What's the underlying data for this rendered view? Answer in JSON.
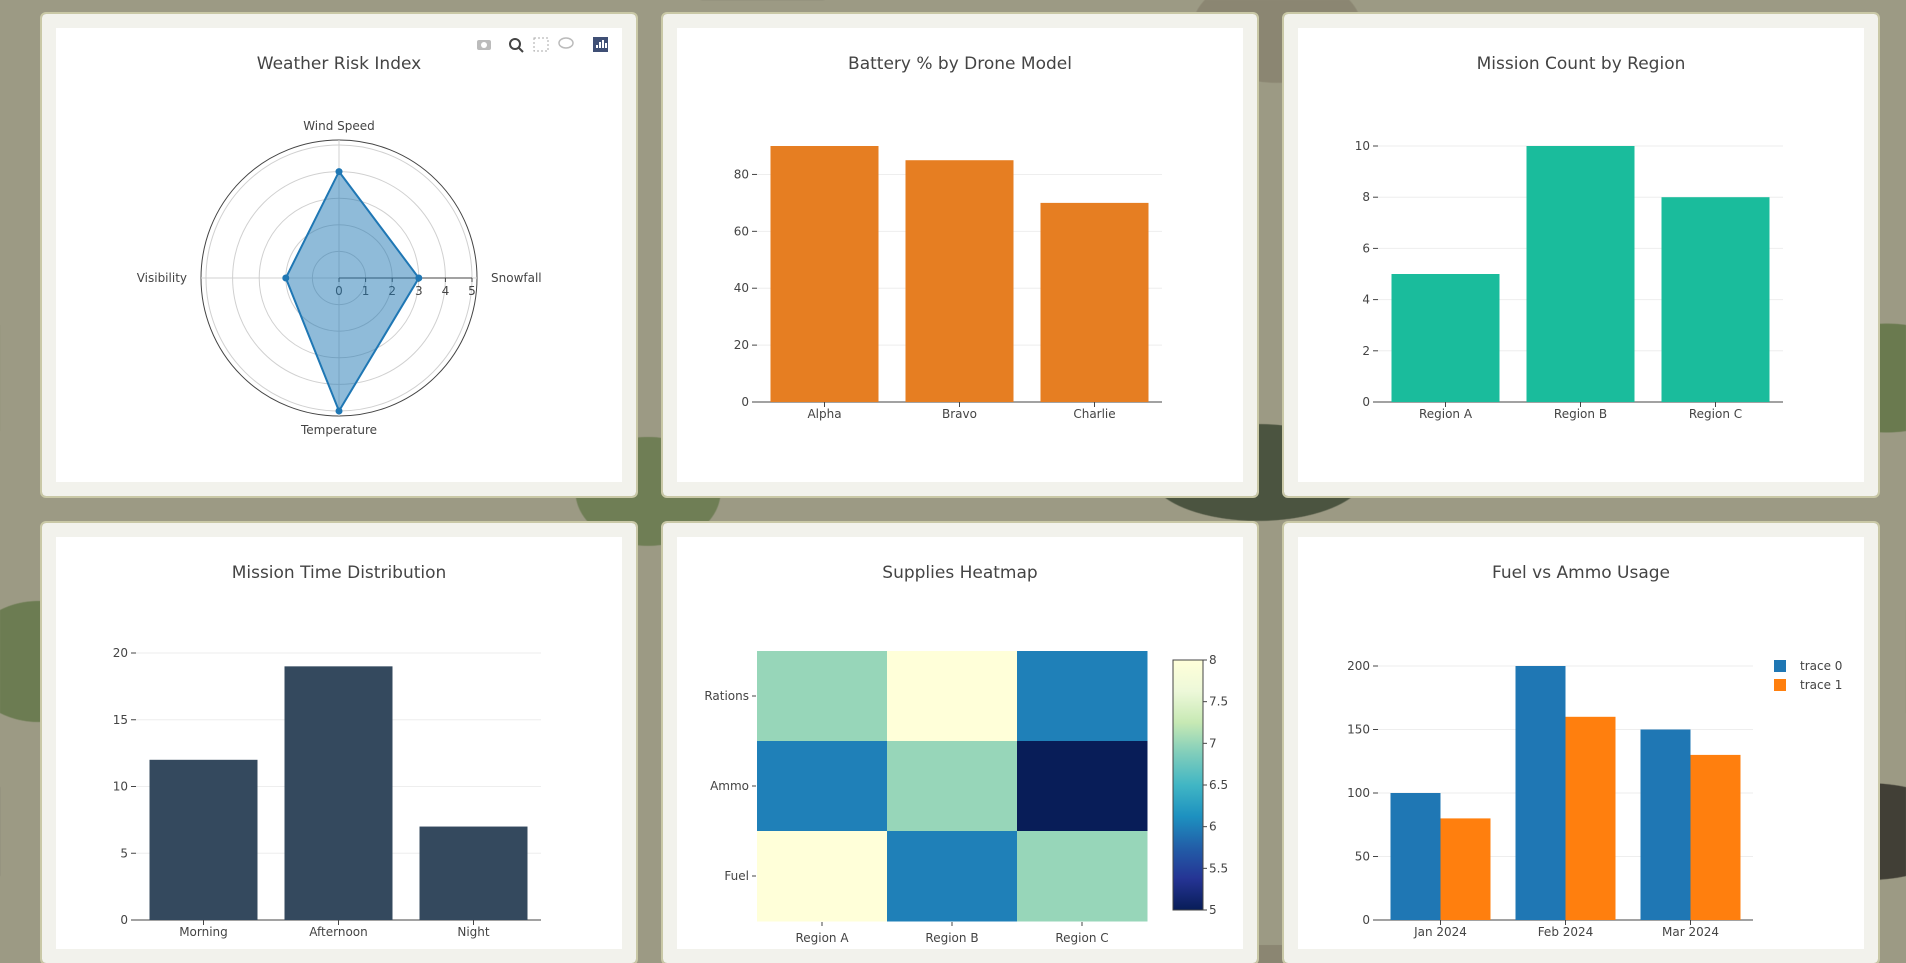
{
  "charts": [
    {
      "id": "radar",
      "type": "radar",
      "title": "Weather Risk Index",
      "axes": [
        "Wind Speed",
        "Snowfall",
        "Temperature",
        "Visibility"
      ],
      "values": [
        4,
        3,
        5,
        2
      ],
      "radial_ticks": [
        "0",
        "1",
        "2",
        "3",
        "4",
        "5"
      ],
      "range": [
        0,
        5
      ],
      "color": "#1f77b4",
      "modebar": [
        "camera-icon",
        "zoom-icon",
        "select-box-icon",
        "comment-icon",
        "plotly-logo-icon"
      ]
    },
    {
      "id": "battery",
      "type": "bar",
      "title": "Battery % by Drone Model",
      "categories": [
        "Alpha",
        "Bravo",
        "Charlie"
      ],
      "values": [
        90,
        85,
        70
      ],
      "ylim": [
        0,
        90
      ],
      "yticks": [
        0,
        20,
        40,
        60,
        80
      ],
      "color": "#e67e22"
    },
    {
      "id": "missions",
      "type": "bar",
      "title": "Mission Count by Region",
      "categories": [
        "Region A",
        "Region B",
        "Region C"
      ],
      "values": [
        5,
        10,
        8
      ],
      "ylim": [
        0,
        10
      ],
      "yticks": [
        0,
        2,
        4,
        6,
        8,
        10
      ],
      "color": "#1abc9c"
    },
    {
      "id": "mtime",
      "type": "bar",
      "title": "Mission Time Distribution",
      "categories": [
        "Morning",
        "Afternoon",
        "Night"
      ],
      "values": [
        12,
        19,
        7
      ],
      "ylim": [
        0,
        20
      ],
      "yticks": [
        0,
        5,
        10,
        15,
        20
      ],
      "color": "#34495e"
    },
    {
      "id": "heat",
      "type": "heatmap",
      "title": "Supplies Heatmap",
      "x": [
        "Region A",
        "Region B",
        "Region C"
      ],
      "y": [
        "Rations",
        "Ammo",
        "Fuel"
      ],
      "z": [
        [
          7,
          8,
          6
        ],
        [
          6,
          7,
          5
        ],
        [
          8,
          6,
          7
        ]
      ],
      "zlim": [
        5,
        8
      ],
      "colorbar_ticks": [
        "5",
        "5.5",
        "6",
        "6.5",
        "7",
        "7.5",
        "8"
      ]
    },
    {
      "id": "fuel",
      "type": "grouped-bar",
      "title": "Fuel vs Ammo Usage",
      "categories": [
        "Jan 2024",
        "Feb 2024",
        "Mar 2024"
      ],
      "series": [
        {
          "name": "trace 0",
          "values": [
            100,
            200,
            150
          ],
          "color": "#1f77b4"
        },
        {
          "name": "trace 1",
          "values": [
            80,
            160,
            130
          ],
          "color": "#ff7f0e"
        }
      ],
      "ylim": [
        0,
        200
      ],
      "yticks": [
        0,
        50,
        100,
        150,
        200
      ],
      "legend": "top-right"
    }
  ]
}
